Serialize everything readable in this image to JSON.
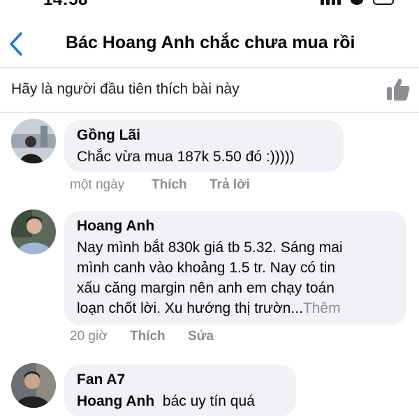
{
  "status_bar": {
    "time": "14:58"
  },
  "header": {
    "title": "Bác Hoang Anh chắc chưa mua rồi",
    "back_icon": "chevron-left-icon"
  },
  "likes": {
    "text": "Hãy là người đầu tiên thích bài này",
    "icon": "thumbs-up-icon"
  },
  "comments": [
    {
      "author": "Gồng Lãi",
      "text": "Chắc vừa mua 187k 5.50 đó :)))))",
      "time": "một ngày",
      "like_label": "Thích",
      "reply_label": "Trả lời"
    },
    {
      "author": "Hoang Anh",
      "lines": [
        "Nay mình bắt 830k giá tb 5.32. Sáng mai",
        "mình canh vào khoảng 1.5 tr. Nay có tin",
        "xấu căng margin nên anh em chạy toán",
        "loạn chốt lời. Xu hướng thị trườn..."
      ],
      "more_label": "Thêm",
      "time": "20 giờ",
      "like_label": "Thích",
      "edit_label": "Sửa"
    },
    {
      "author": "Fan A7",
      "mention": "Hoang Anh",
      "text": "bác uy tín quá"
    }
  ],
  "colors": {
    "accent": "#1877f2",
    "bubble": "#f0f2f5",
    "meta": "#8a8d91",
    "divider": "#e4e6eb"
  }
}
